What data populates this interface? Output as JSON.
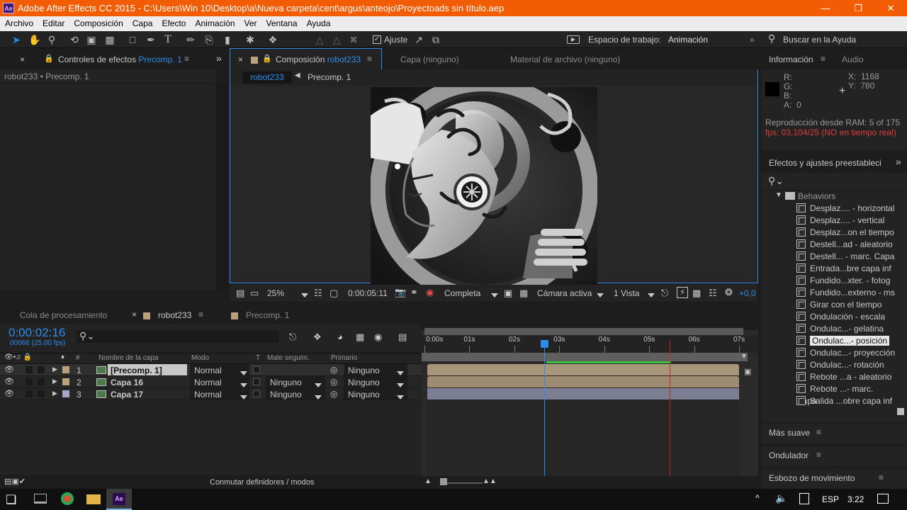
{
  "app": {
    "logo": "Ae",
    "title": "Adobe After Effects CC 2015 - C:\\Users\\Win 10\\Desktop\\a\\Nueva carpeta\\cent\\argus\\anteojo\\Proyectoads sin título.aep"
  },
  "menu": [
    "Archivo",
    "Editar",
    "Composición",
    "Capa",
    "Efecto",
    "Animación",
    "Ver",
    "Ventana",
    "Ayuda"
  ],
  "toolbar": {
    "snap_label": "Ajuste",
    "workspace_label": "Espacio de trabajo:",
    "workspace_value": "Animación",
    "search_placeholder": "Buscar en la Ayuda"
  },
  "effects_panel": {
    "tab_label": "Controles de efectos",
    "tab_comp": "Precomp. 1",
    "breadcrumb": "robot233 • Precomp. 1"
  },
  "viewer": {
    "tabs": {
      "comp_label": "Composición",
      "comp_name": "robot233",
      "layer": "Capa (ninguno)",
      "footage": "Material de archivo (ninguno)"
    },
    "crumb_active": "robot233",
    "crumb_next": "Precomp. 1",
    "zoom": "25%",
    "timecode": "0:00:05:11",
    "resolution": "Completa",
    "camera": "Cámara activa",
    "views": "1 Vista",
    "exposure": "+0,0"
  },
  "info_panel": {
    "tab_info": "Información",
    "tab_audio": "Audio",
    "r_label": "R:",
    "g_label": "G:",
    "b_label": "B:",
    "a_label": "A:",
    "a_value": "0",
    "x_label": "X:",
    "x_value": "1168",
    "y_label": "Y:",
    "y_value": "780",
    "ram_preview": "Reproducción desde RAM: 5 of 175",
    "fps_warning": "fps: 03,104/25 (NO en tiempo real)"
  },
  "presets_panel": {
    "title": "Efectos y ajustes preestableci",
    "folder": "Behaviors",
    "items": [
      "Desplaz.... - horizontal",
      "Desplaz.... - vertical",
      "Desplaz...on el tiempo",
      "Destell...ad - aleatorio",
      "Destell... - marc. Capa",
      "Entrada...bre capa inf",
      "Fundido...xter. - fotog",
      "Fundido...externo - ms",
      "Girar con el tiempo",
      "Ondulación - escala",
      "Ondulac...- gelatina",
      "Ondulac...- posición",
      "Ondulac...- proyección",
      "Ondulac...- rotación",
      "Rebote ...a - aleatorio",
      "Rebote ...- marc. Capa",
      "Salida ...obre capa inf"
    ],
    "selected_index": 11
  },
  "collapsed_panels": [
    "Más suave",
    "Ondulador",
    "Esbozo de movimiento"
  ],
  "timeline": {
    "tabs": {
      "render_queue": "Cola de procesamiento",
      "comp1": "robot233",
      "comp2": "Precomp. 1"
    },
    "timecode": "0:00:02:16",
    "frame_info": "00066 (25.00 fps)",
    "headers": {
      "num": "#",
      "layer_name": "Nombre de la capa",
      "mode": "Modo",
      "t": "T",
      "matte": "Mate seguim.",
      "parent": "Primario"
    },
    "ruler": [
      "0:00s",
      "01s",
      "02s",
      "03s",
      "04s",
      "05s",
      "06s",
      "07s"
    ],
    "layers": [
      {
        "num": "1",
        "name": "[Precomp. 1]",
        "mode": "Normal",
        "matte": "",
        "parent": "Ninguno",
        "color": "#b9a17c"
      },
      {
        "num": "2",
        "name": "Capa 16",
        "mode": "Normal",
        "matte": "Ninguno",
        "parent": "Ninguno",
        "color": "#b9a17c"
      },
      {
        "num": "3",
        "name": "Capa 17",
        "mode": "Normal",
        "matte": "Ninguno",
        "parent": "Ninguno",
        "color": "#a4a8c6"
      }
    ],
    "footer_label": "Conmutar definidores / modos"
  },
  "taskbar": {
    "lang": "ESP",
    "time": "3:22"
  },
  "colors": {
    "accent": "#2d8ceb",
    "titlebar": "#f25c05",
    "warning": "#e03c3c",
    "playhead": "#2d8ceb",
    "work_area": "#3fbf3f"
  }
}
